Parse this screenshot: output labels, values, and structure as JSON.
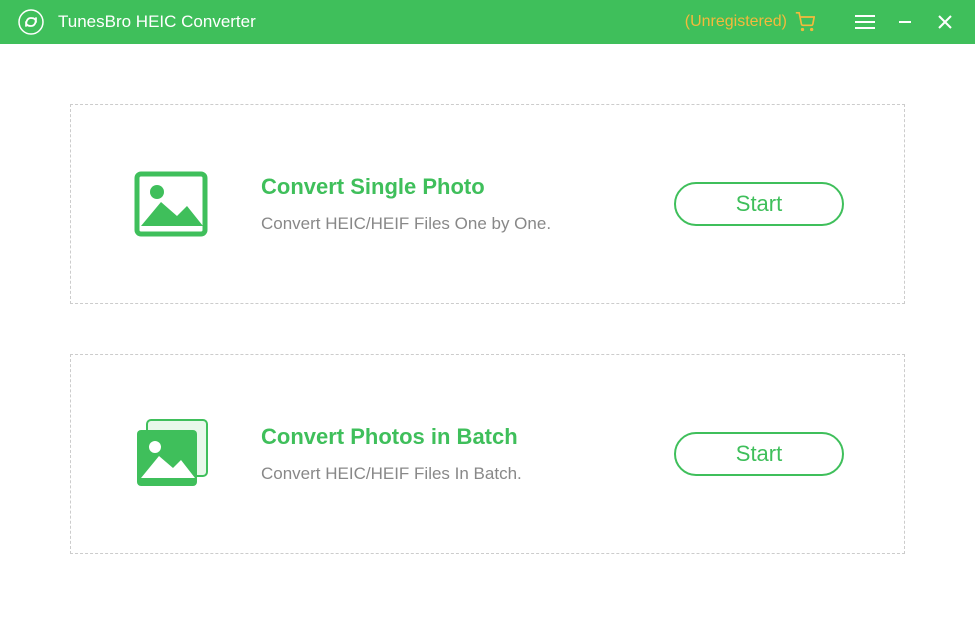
{
  "titlebar": {
    "app_title": "TunesBro HEIC Converter",
    "unregistered_label": "(Unregistered)"
  },
  "options": {
    "single": {
      "title": "Convert Single Photo",
      "desc": "Convert HEIC/HEIF Files One by One.",
      "button": "Start"
    },
    "batch": {
      "title": "Convert Photos in Batch",
      "desc": "Convert HEIC/HEIF Files In Batch.",
      "button": "Start"
    }
  },
  "colors": {
    "accent": "#3fbf5b",
    "warning": "#f5b93c"
  }
}
